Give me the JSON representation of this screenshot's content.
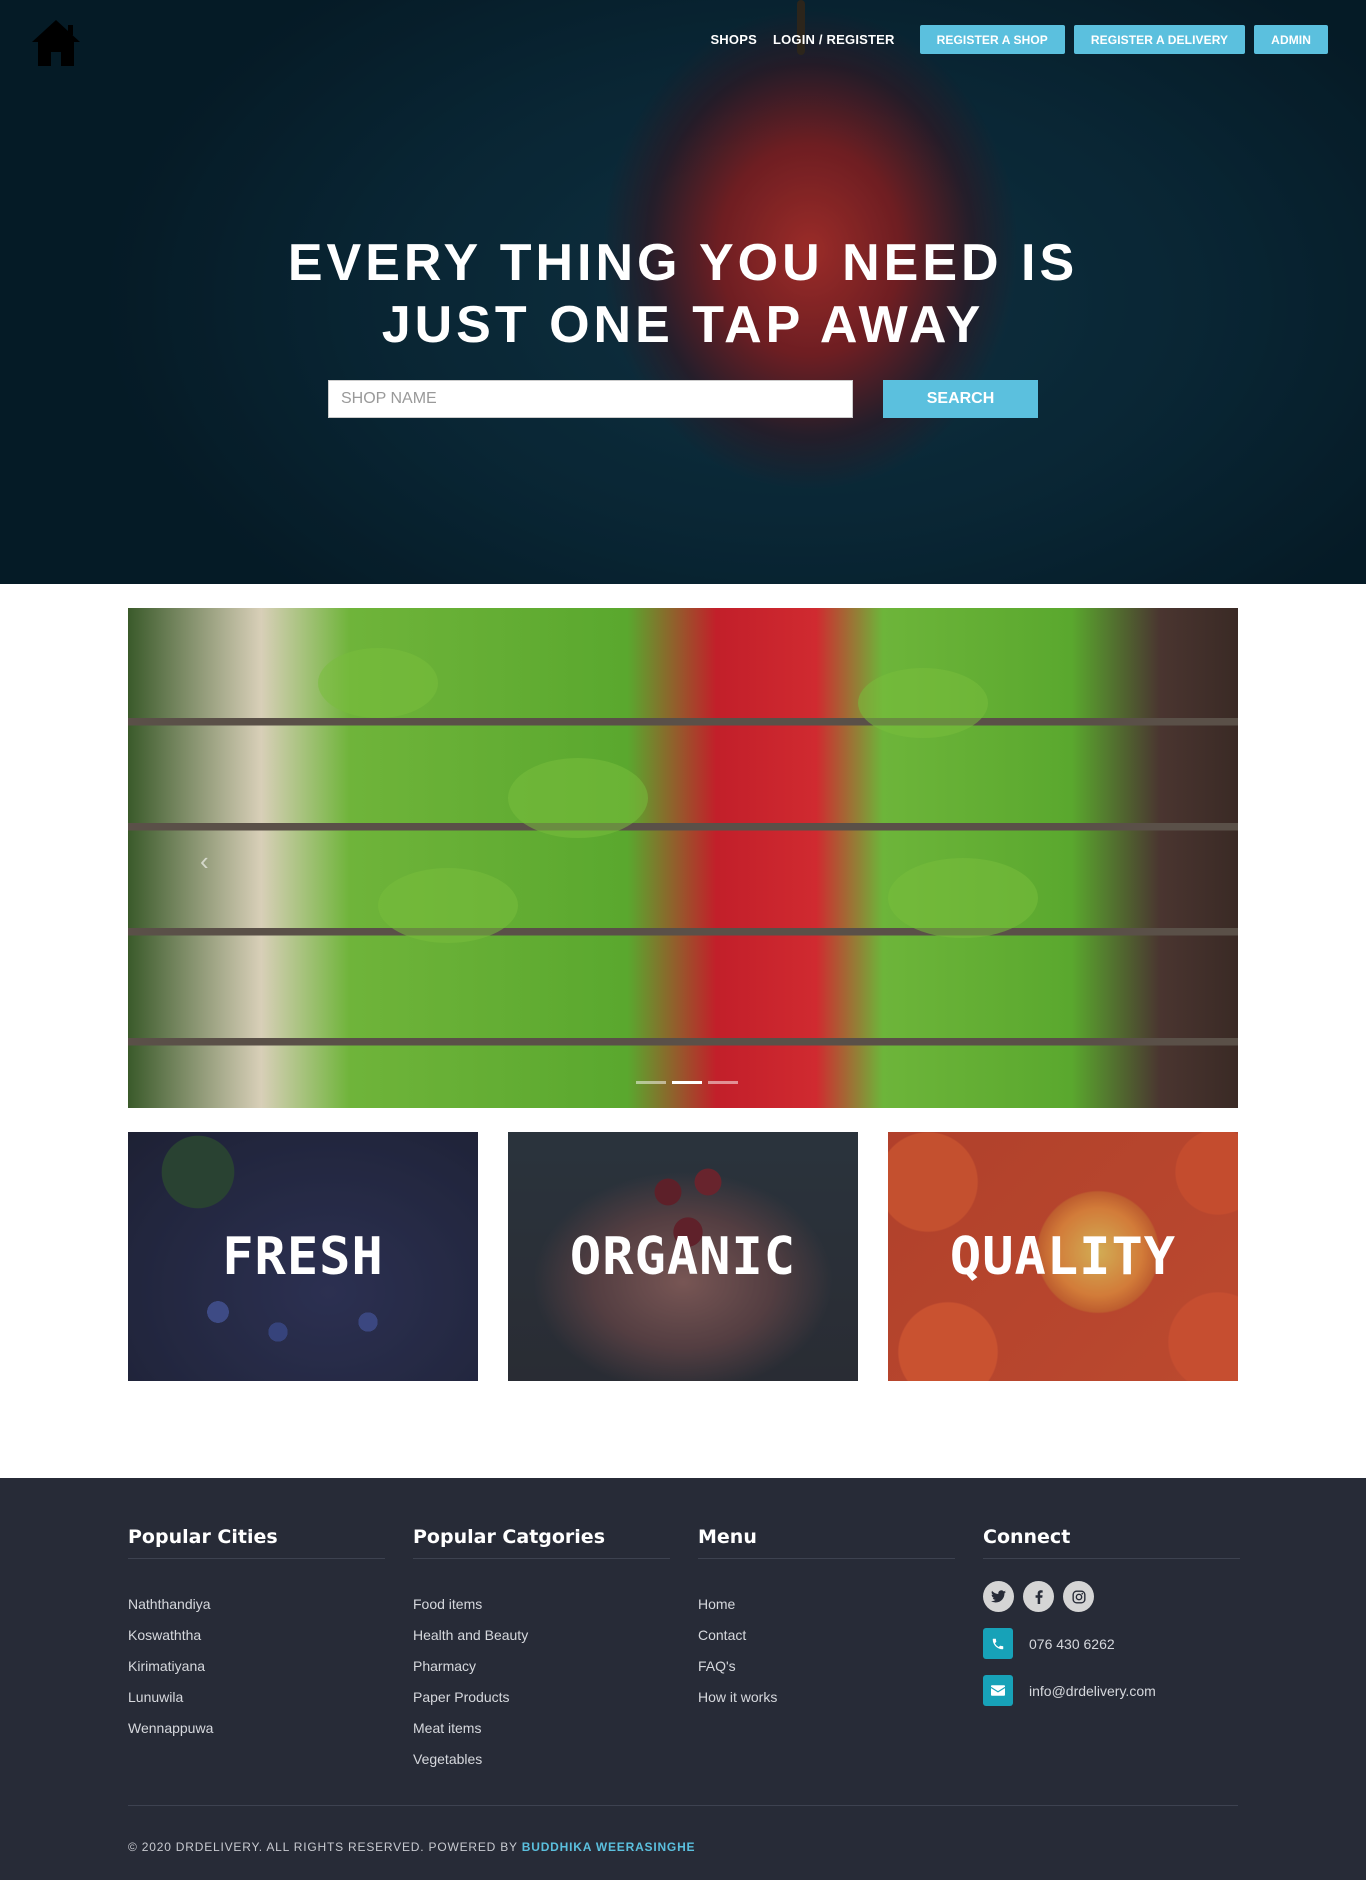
{
  "nav": {
    "links": [
      "SHOPS",
      "LOGIN / REGISTER"
    ],
    "buttons": [
      "REGISTER A SHOP",
      "REGISTER A DELIVERY",
      "ADMIN"
    ]
  },
  "hero": {
    "title_line1": "EVERY THING YOU NEED IS",
    "title_line2": "JUST ONE TAP AWAY",
    "search_placeholder": "SHOP NAME",
    "search_button": "SEARCH"
  },
  "tiles": [
    "FRESH",
    "ORGANIC",
    "QUALITY"
  ],
  "footer": {
    "cities": {
      "heading": "Popular Cities",
      "items": [
        "Naththandiya",
        "Koswaththa",
        "Kirimatiyana",
        "Lunuwila",
        "Wennappuwa"
      ]
    },
    "categories": {
      "heading": "Popular Catgories",
      "items": [
        "Food items",
        "Health and Beauty",
        "Pharmacy",
        "Paper Products",
        "Meat items",
        "Vegetables"
      ]
    },
    "menu": {
      "heading": "Menu",
      "items": [
        "Home",
        "Contact",
        "FAQ's",
        "How it works"
      ]
    },
    "connect": {
      "heading": "Connect",
      "social_icons": [
        "twitter-icon",
        "facebook-icon",
        "instagram-icon"
      ],
      "phone": "076 430 6262",
      "email": "info@drdelivery.com"
    },
    "copyright_text": "© 2020 DRDELIVERY. ALL RIGHTS RESERVED. POWERED BY ",
    "author": "BUDDHIKA WEERASINGHE"
  },
  "colors": {
    "accent": "#5bc0de",
    "footer_bg": "#272b37",
    "contact_icon_bg": "#17a2b8"
  }
}
